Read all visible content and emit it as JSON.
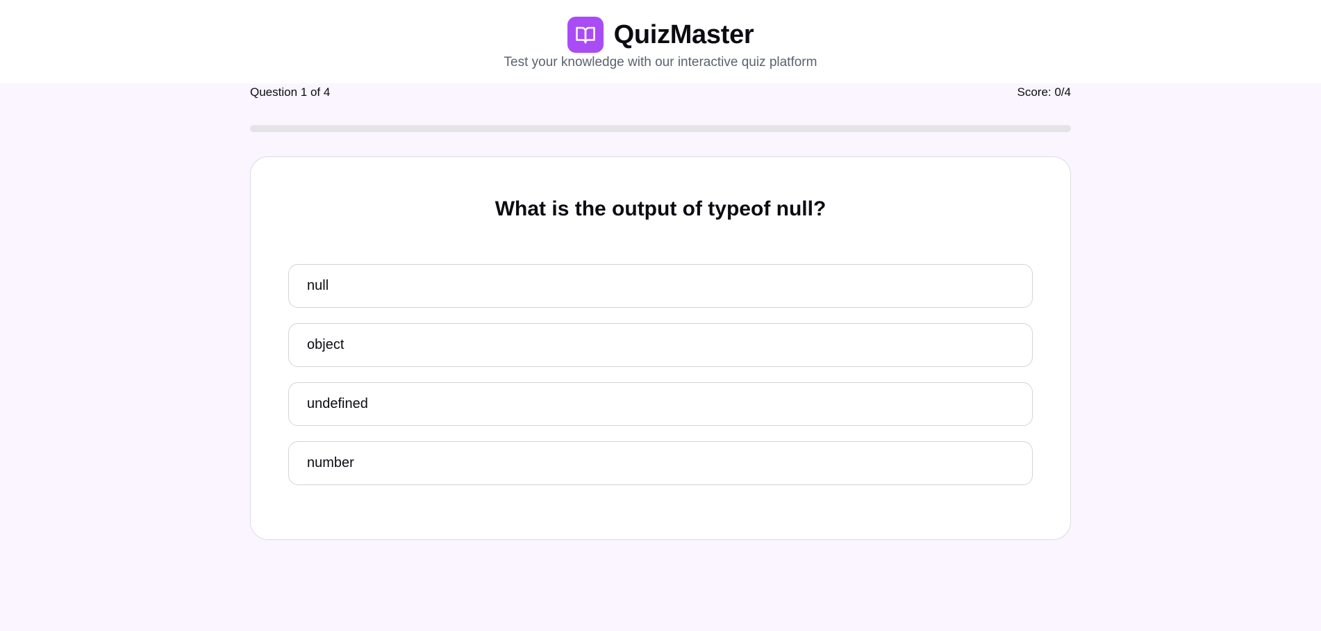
{
  "header": {
    "logo_icon": "book-open-icon",
    "accent_color": "#a94cf6",
    "title": "QuizMaster",
    "subtitle": "Test your knowledge with our interactive quiz platform"
  },
  "status": {
    "question_progress": "Question 1 of 4",
    "score": "Score: 0/4",
    "progress_fraction": 0
  },
  "question": {
    "text": "What is the output of typeof null?",
    "options": [
      {
        "label": "null"
      },
      {
        "label": "object"
      },
      {
        "label": "undefined"
      },
      {
        "label": "number"
      }
    ]
  }
}
